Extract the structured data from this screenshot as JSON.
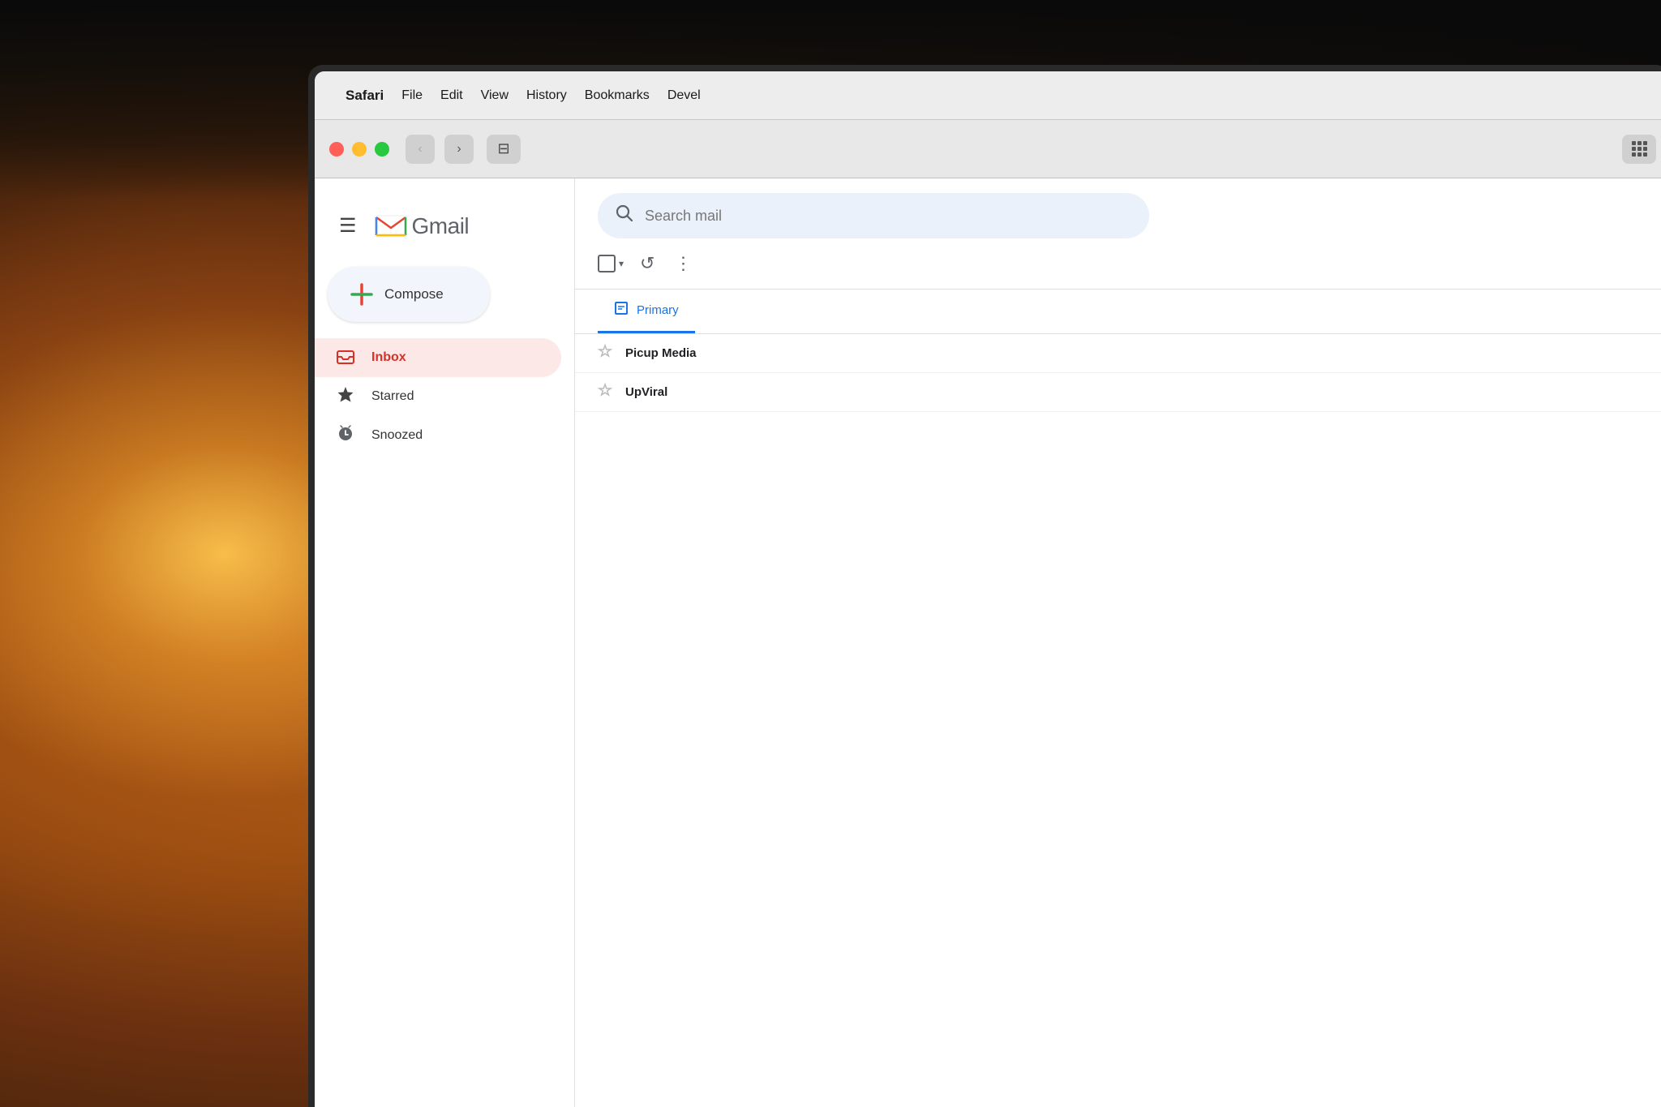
{
  "background": {
    "color_left": "#c87020",
    "color_right": "#0a0a0a"
  },
  "menubar": {
    "apple_symbol": "",
    "app_name": "Safari",
    "items": [
      "File",
      "Edit",
      "View",
      "History",
      "Bookmarks",
      "Devel"
    ]
  },
  "browser": {
    "back_btn": "‹",
    "forward_btn": "›",
    "sidebar_icon": "⊡",
    "grid_icon": "⋮⋮⋮"
  },
  "gmail": {
    "hamburger": "☰",
    "logo_text": "Gmail",
    "compose_label": "Compose",
    "search_placeholder": "Search mail",
    "nav_items": [
      {
        "id": "inbox",
        "label": "Inbox",
        "icon": "inbox",
        "active": true
      },
      {
        "id": "starred",
        "label": "Starred",
        "icon": "star",
        "active": false
      },
      {
        "id": "snoozed",
        "label": "Snoozed",
        "icon": "clock",
        "active": false
      }
    ],
    "toolbar": {
      "select_all": "Select all",
      "refresh": "↺",
      "more": "⋮"
    },
    "tabs": [
      {
        "id": "primary",
        "label": "Primary",
        "icon": "□",
        "active": true
      }
    ],
    "emails": [
      {
        "sender": "Picup Media",
        "snippet": "",
        "starred": false
      },
      {
        "sender": "UpViral",
        "snippet": "",
        "starred": false
      }
    ]
  }
}
